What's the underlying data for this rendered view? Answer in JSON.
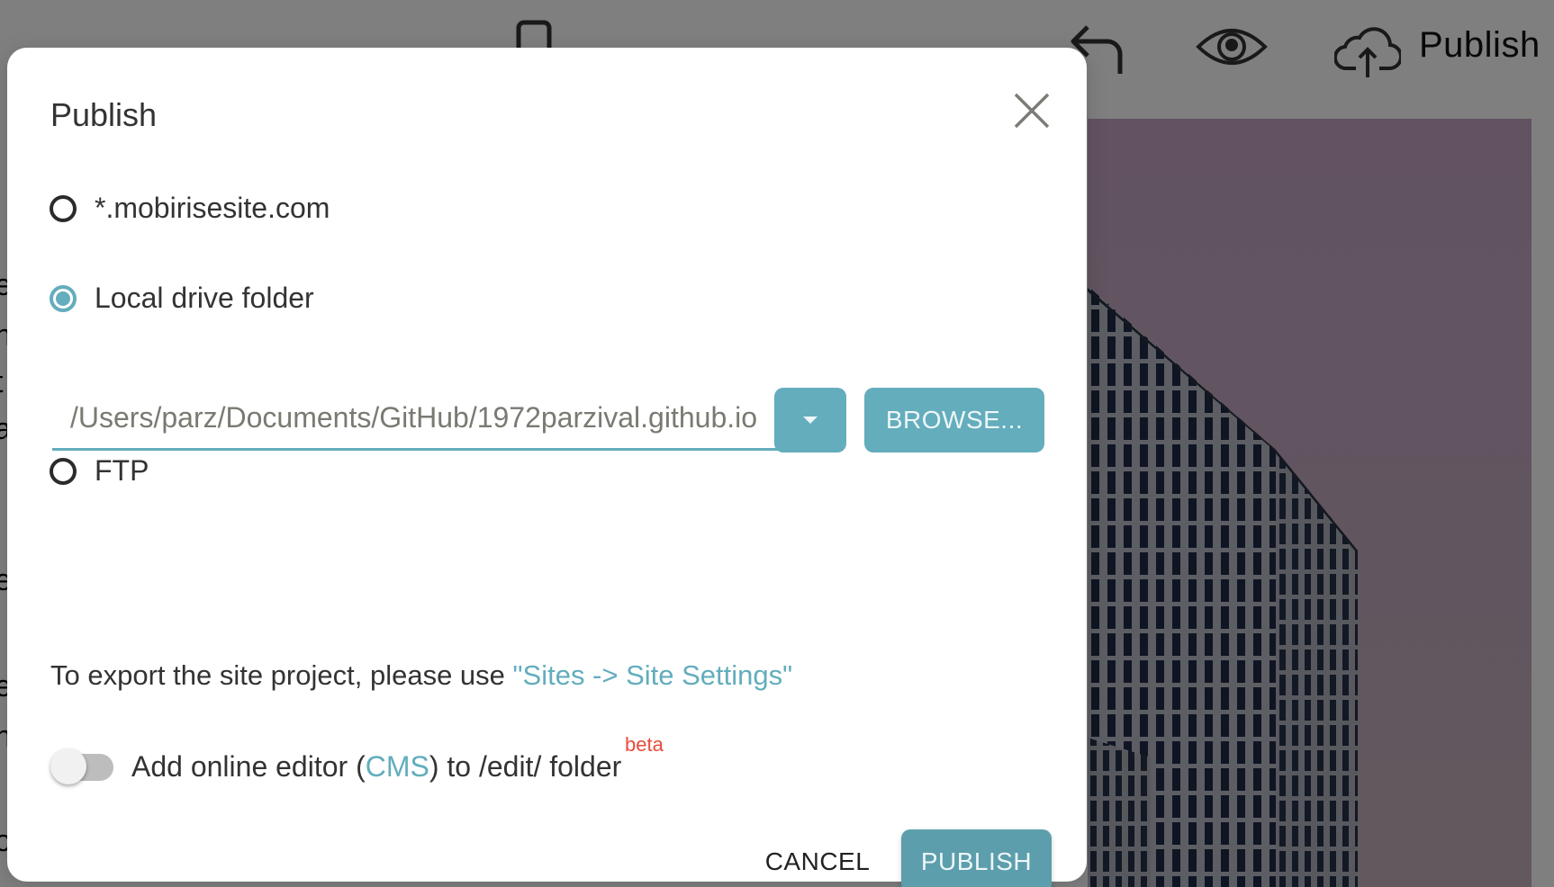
{
  "background_app": {
    "toolbar": {
      "publish_label": "Publish",
      "icons": [
        "mobile-view-icon",
        "undo-icon",
        "preview-eye-icon",
        "cloud-upload-icon"
      ]
    },
    "page_text_fragments": [
      "e",
      "n",
      "t",
      "a",
      "e",
      "e",
      "n",
      "o"
    ]
  },
  "dialog": {
    "title": "Publish",
    "close_icon": "close-x-icon",
    "options": [
      {
        "label": "*.mobirisesite.com",
        "selected": false
      },
      {
        "label": "Local drive folder",
        "selected": true
      },
      {
        "label": "FTP",
        "selected": false
      }
    ],
    "local_folder": {
      "path_value": "/Users/parz/Documents/GitHub/1972parzival.github.io",
      "dropdown_icon": "caret-down-icon",
      "browse_label": "BROWSE..."
    },
    "export_note": {
      "text": "To export the site project, please use ",
      "link": "\"Sites -> Site Settings\""
    },
    "cms_toggle": {
      "enabled": false,
      "prefix": "Add online editor (",
      "link": "CMS",
      "suffix": ") to /edit/ folder",
      "badge": "beta"
    },
    "buttons": {
      "cancel": "CANCEL",
      "publish": "PUBLISH"
    }
  },
  "colors": {
    "accent": "#63adbd",
    "publish_button": "#5c9eac",
    "beta_badge": "#e94b3c",
    "overlay": "rgba(0,0,0,0.5)"
  }
}
